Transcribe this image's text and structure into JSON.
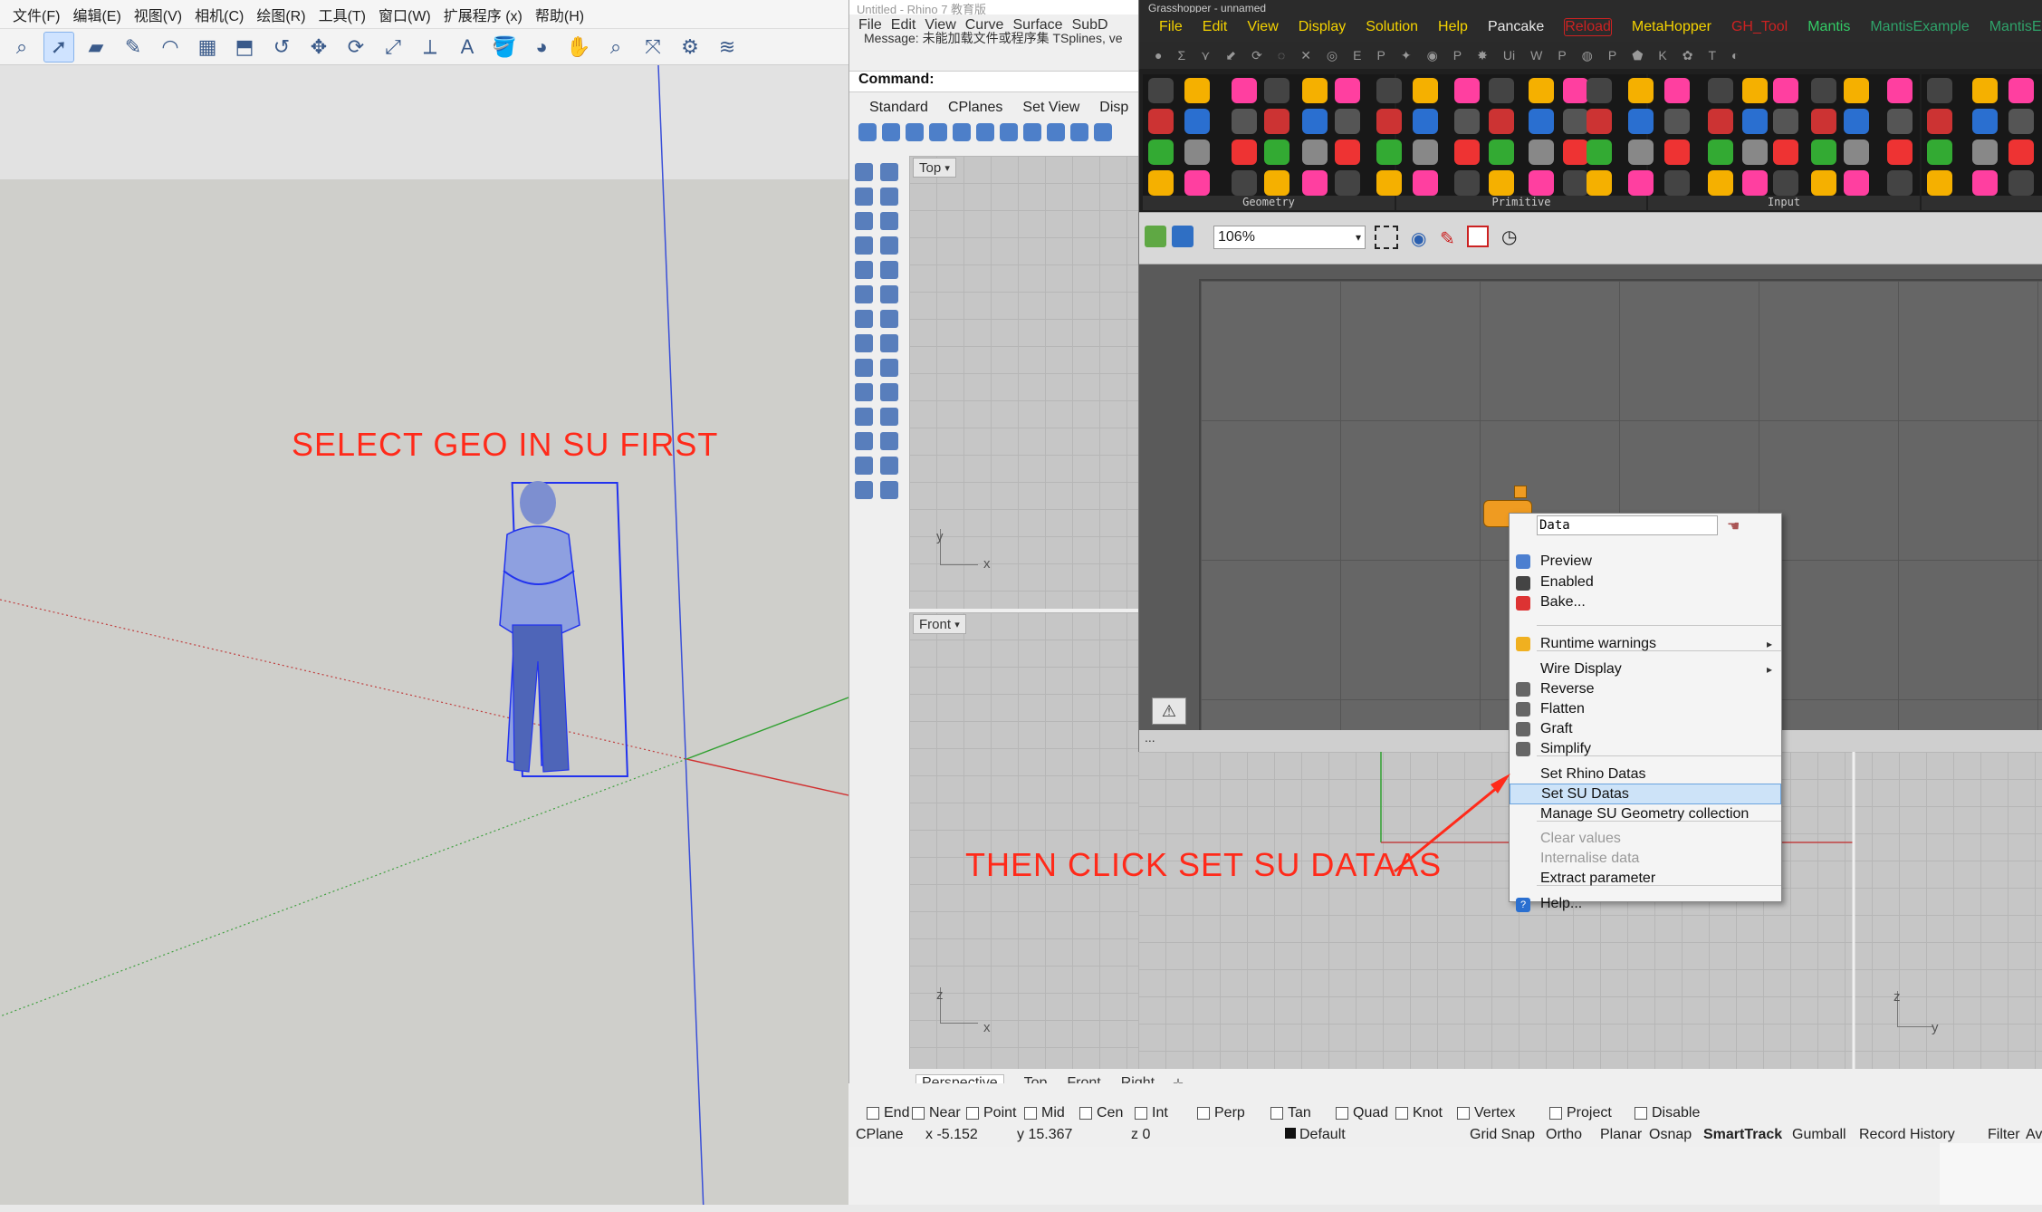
{
  "sketchup": {
    "menu": [
      "文件(F)",
      "编辑(E)",
      "视图(V)",
      "相机(C)",
      "绘图(R)",
      "工具(T)",
      "窗口(W)",
      "扩展程序 (x)",
      "帮助(H)"
    ],
    "annotation_select": "SELECT GEO IN SU FIRST"
  },
  "rhino": {
    "title": "Untitled - Rhino 7 教育版",
    "menu": [
      "File",
      "Edit",
      "View",
      "Curve",
      "Surface",
      "SubD"
    ],
    "message": "Message: 未能加载文件或程序集 TSplines, ve",
    "command_label": "Command:",
    "toolbar_tabs": [
      "Standard",
      "CPlanes",
      "Set View",
      "Disp"
    ],
    "viewport_top": "Top",
    "viewport_front": "Front",
    "axis_y": "y",
    "axis_x": "x",
    "axis_z": "z",
    "viewport_tabs": [
      "Perspective",
      "Top",
      "Front",
      "Right"
    ],
    "osnaps": [
      "End",
      "Near",
      "Point",
      "Mid",
      "Cen",
      "Int",
      "Perp",
      "Tan",
      "Quad",
      "Knot",
      "Vertex",
      "Project",
      "Disable"
    ],
    "status": {
      "cplane": "CPlane",
      "x": "x -5.152",
      "y": "y 15.367",
      "z": "z 0",
      "layer": "Default",
      "toggles": [
        "Grid Snap",
        "Ortho",
        "Planar",
        "Osnap",
        "SmartTrack",
        "Gumball",
        "Record History",
        "Filter",
        "Availa"
      ]
    }
  },
  "grasshopper": {
    "title": "Grasshopper - unnamed",
    "menu": [
      {
        "label": "File",
        "color": "#f5d300"
      },
      {
        "label": "Edit",
        "color": "#f5d300"
      },
      {
        "label": "View",
        "color": "#f5d300"
      },
      {
        "label": "Display",
        "color": "#f5d300"
      },
      {
        "label": "Solution",
        "color": "#f5d300"
      },
      {
        "label": "Help",
        "color": "#f5d300"
      },
      {
        "label": "Pancake",
        "color": "#e8e8e8"
      },
      {
        "label": "Reload",
        "color": "#cc2222"
      },
      {
        "label": "MetaHopper",
        "color": "#f5d300"
      },
      {
        "label": "GH_Tool",
        "color": "#cc2222"
      },
      {
        "label": "Mantis",
        "color": "#33cc66"
      },
      {
        "label": "MantisExample",
        "color": "#2fa36a"
      },
      {
        "label": "MantisEX",
        "color": "#2fa36a"
      }
    ],
    "panels": [
      "Geometry",
      "Primitive",
      "Input"
    ],
    "zoom": "106%",
    "status_dots": "..."
  },
  "context_menu": {
    "name_field": "Data",
    "items": [
      {
        "label": "Preview",
        "icon": "preview-icon",
        "enabled": true
      },
      {
        "label": "Enabled",
        "icon": "enabled-icon",
        "enabled": true
      },
      {
        "label": "Bake...",
        "icon": "bake-icon",
        "enabled": true
      },
      {
        "label": "Runtime warnings",
        "icon": "warning-icon",
        "enabled": true,
        "submenu": true
      },
      {
        "label": "Wire Display",
        "icon": "",
        "enabled": true,
        "submenu": true
      },
      {
        "label": "Reverse",
        "icon": "reverse-icon",
        "enabled": true
      },
      {
        "label": "Flatten",
        "icon": "flatten-icon",
        "enabled": true
      },
      {
        "label": "Graft",
        "icon": "graft-icon",
        "enabled": true
      },
      {
        "label": "Simplify",
        "icon": "simplify-icon",
        "enabled": true
      },
      {
        "label": "Set Rhino Datas",
        "icon": "",
        "enabled": true
      },
      {
        "label": "Set SU Datas",
        "icon": "",
        "enabled": true,
        "highlighted": true
      },
      {
        "label": "Manage SU Geometry collection",
        "icon": "",
        "enabled": true
      },
      {
        "label": "Clear values",
        "icon": "",
        "enabled": false
      },
      {
        "label": "Internalise data",
        "icon": "",
        "enabled": false
      },
      {
        "label": "Extract parameter",
        "icon": "",
        "enabled": true
      },
      {
        "label": "Help...",
        "icon": "help-icon",
        "enabled": true
      }
    ]
  },
  "annotation_click": "THEN CLICK SET SU DATAAS",
  "colors": {
    "annotation": "#ff2a1a",
    "gh_menu_bg": "#2b2b2b",
    "highlight": "#cde3f8"
  }
}
